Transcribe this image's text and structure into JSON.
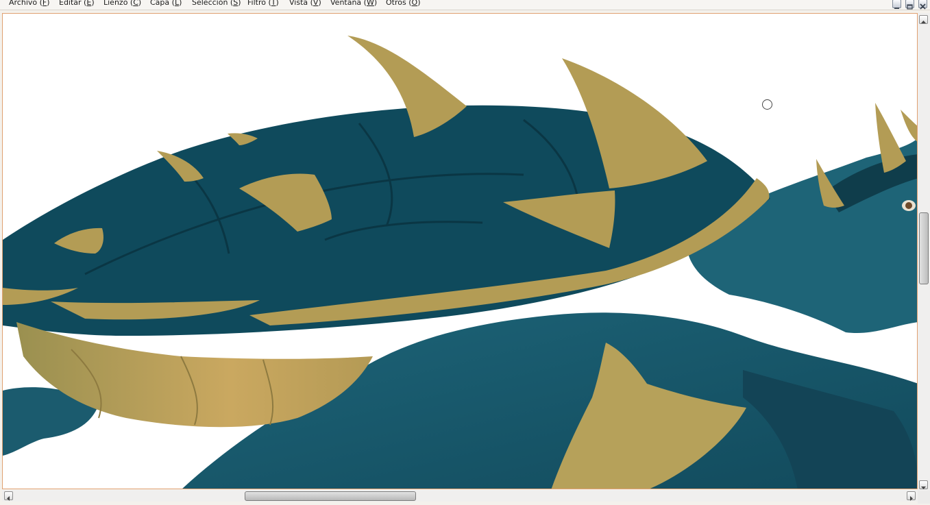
{
  "menubar": {
    "items": [
      {
        "label": "Archivo (",
        "key": "F",
        "close": ")"
      },
      {
        "label": "Editar (",
        "key": "E",
        "close": ")"
      },
      {
        "label": "Lienzo (",
        "key": "C",
        "close": ")"
      },
      {
        "label": "Capa (",
        "key": "L",
        "close": ")"
      },
      {
        "label": "Selección (",
        "key": "S",
        "close": ")"
      },
      {
        "label": "Filtro (",
        "key": "T",
        "close": ")"
      },
      {
        "label": "Vista (",
        "key": "V",
        "close": ")"
      },
      {
        "label": "Ventana (",
        "key": "W",
        "close": ")"
      },
      {
        "label": "Otros (",
        "key": "O",
        "close": ")"
      }
    ]
  },
  "window_controls": [
    "minimize-icon",
    "restore-icon",
    "close-icon"
  ],
  "canvas": {
    "background": "#ffffff",
    "colors": {
      "shell": "#0f4a5c",
      "shell_dark": "#0b3846",
      "spikes": "#b39c55",
      "skin": "#1a5c72",
      "belly": "#c6a65a"
    }
  },
  "scrollbars": {
    "vertical_thumb_position": 0.49,
    "horizontal_thumb_position": 0.32
  }
}
